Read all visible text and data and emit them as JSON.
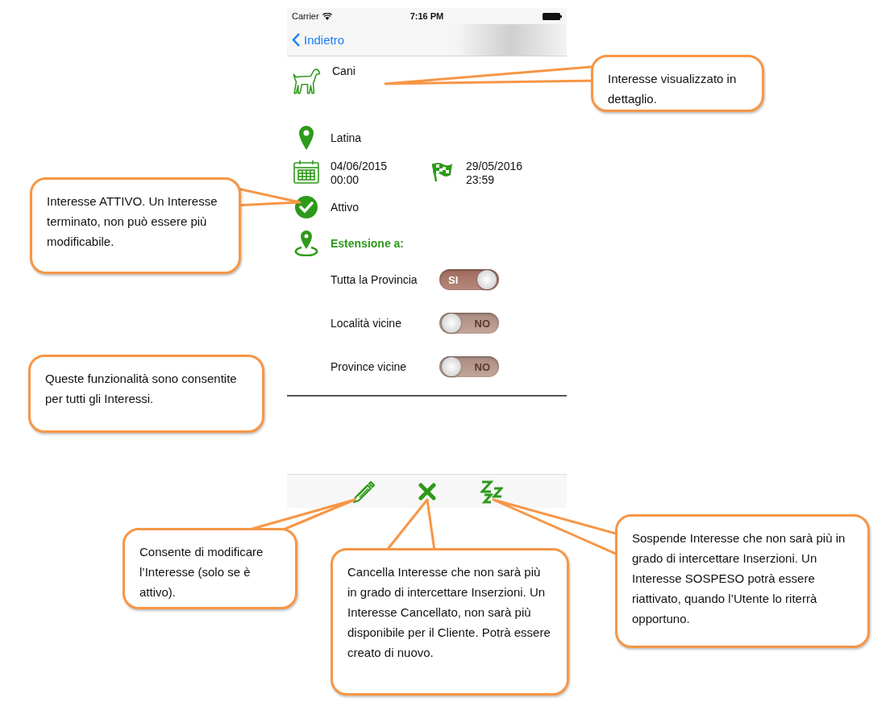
{
  "status_bar": {
    "carrier": "Carrier",
    "time": "7:16 PM"
  },
  "nav": {
    "back": "Indietro"
  },
  "interest": {
    "name": "Cani",
    "place": "Latina",
    "start_date": "04/06/2015",
    "start_time": "00:00",
    "end_date": "29/05/2016",
    "end_time": "23:59",
    "status": "Attivo",
    "active": true
  },
  "extension": {
    "title": "Estensione a:",
    "options": [
      {
        "label": "Tutta la Provincia",
        "on": true,
        "switch_text": "SI"
      },
      {
        "label": "Località vicine",
        "on": false,
        "switch_text": "NO"
      },
      {
        "label": "Province vicine",
        "on": false,
        "switch_text": "NO"
      }
    ]
  },
  "callouts": [
    {
      "text": "Interesse visualizzato in dettaglio."
    },
    {
      "text": "Interesse ATTIVO. Un Interesse terminato, non può essere più modificabile."
    },
    {
      "text": "Queste funzionalità sono consentite per tutti gli Interessi."
    },
    {
      "text": "Consente di modificare l’Interesse (solo se è attivo)."
    },
    {
      "text": "Cancella Interesse che non sarà più in grado di intercettare Inserzioni. Un Interesse Cancellato, non sarà più disponibile per il Cliente. Potrà essere creato di nuovo."
    },
    {
      "text": "Sospende Interesse che non sarà più in grado di intercettare Inserzioni. Un Interesse SOSPESO potrà essere riattivato, quando l’Utente lo riterrà opportuno."
    }
  ]
}
